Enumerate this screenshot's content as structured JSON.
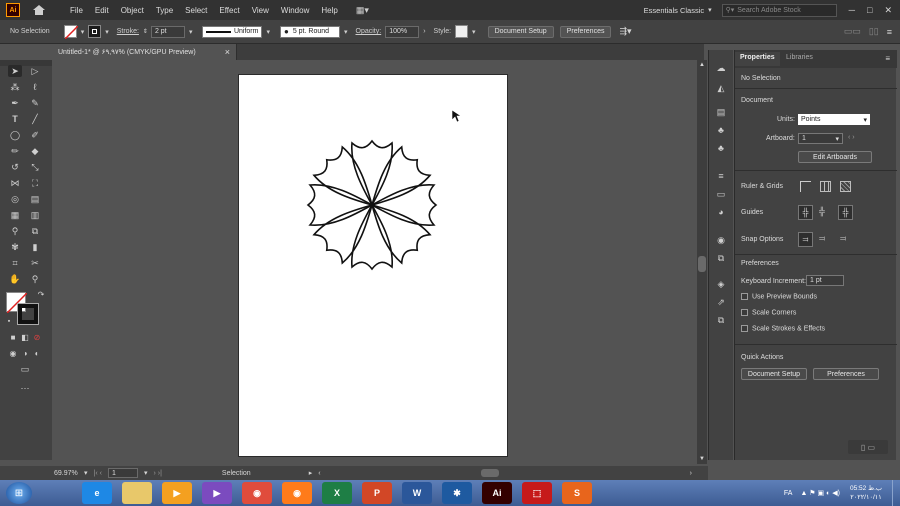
{
  "menubar": {
    "logo": "Ai",
    "items": [
      "File",
      "Edit",
      "Object",
      "Type",
      "Select",
      "Effect",
      "View",
      "Window",
      "Help"
    ],
    "workspace": "Essentials Classic",
    "search_placeholder": "Search Adobe Stock"
  },
  "control": {
    "selection": "No Selection",
    "stroke_label": "Stroke:",
    "stroke_value": "2 pt",
    "profile": "Uniform",
    "brush": "5 pt. Round",
    "opacity_label": "Opacity:",
    "opacity_value": "100%",
    "style_label": "Style:",
    "doc_setup": "Document Setup",
    "preferences": "Preferences"
  },
  "document": {
    "tab_title": "Untitled-1* @ ۶۹,۹۷% (CMYK/GPU Preview)",
    "close": "×"
  },
  "props_panel": {
    "tabs": [
      "Properties",
      "Libraries"
    ],
    "no_selection": "No Selection",
    "document_header": "Document",
    "units_label": "Units:",
    "units_value": "Points",
    "artboard_label": "Artboard:",
    "artboard_value": "1",
    "edit_artboards": "Edit Artboards",
    "rulers_grids": "Ruler & Grids",
    "guides": "Guides",
    "snap_options": "Snap Options",
    "preferences_header": "Preferences",
    "keyboard_increment_label": "Keyboard Increment:",
    "keyboard_increment_value": "1 pt",
    "use_preview_bounds": "Use Preview Bounds",
    "scale_corners": "Scale Corners",
    "scale_strokes": "Scale Strokes & Effects",
    "quick_actions": "Quick Actions",
    "qa_document_setup": "Document Setup",
    "qa_preferences": "Preferences"
  },
  "statusbar": {
    "zoom": "69.97%",
    "artboard_nav": "1",
    "tool_name": "Selection"
  },
  "taskbar": {
    "lang": "FA",
    "time": "05:52 ب.ظ",
    "date": "۲۰۲۲/۱۰/۱۱",
    "apps": [
      {
        "label": "",
        "color": "#1c79c8"
      },
      {
        "label": "e",
        "color": "#1e88e5"
      },
      {
        "label": "",
        "color": "#e8c86a"
      },
      {
        "label": "▶",
        "color": "#f4a020"
      },
      {
        "label": "▶",
        "color": "#7b4bbf"
      },
      {
        "label": "◉",
        "color": "#e04c3c"
      },
      {
        "label": "◉",
        "color": "#ff7b1a"
      },
      {
        "label": "X",
        "color": "#1e7e45"
      },
      {
        "label": "P",
        "color": "#d24726"
      },
      {
        "label": "W",
        "color": "#2b579a"
      },
      {
        "label": "✱",
        "color": "#1e5aa0"
      },
      {
        "label": "Ai",
        "color": "#330000"
      },
      {
        "label": "⬚",
        "color": "#c61a1a"
      },
      {
        "label": "S",
        "color": "#e8651c"
      }
    ]
  }
}
